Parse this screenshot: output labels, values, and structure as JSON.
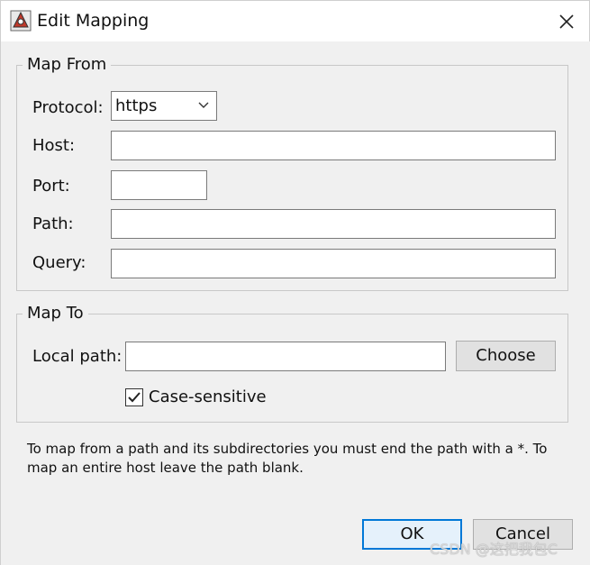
{
  "window": {
    "title": "Edit Mapping",
    "app_icon": "java-app-icon",
    "close_icon": "close-icon"
  },
  "map_from": {
    "legend": "Map From",
    "protocol_label": "Protocol:",
    "protocol_value": "https",
    "host_label": "Host:",
    "host_value": "",
    "port_label": "Port:",
    "port_value": "",
    "path_label": "Path:",
    "path_value": "",
    "query_label": "Query:",
    "query_value": ""
  },
  "map_to": {
    "legend": "Map To",
    "local_path_label": "Local path:",
    "local_path_value": "",
    "choose_label": "Choose",
    "case_sensitive_label": "Case-sensitive",
    "case_sensitive_checked": true
  },
  "help_text": "To map from a path and its subdirectories you must end the path with a *. To map an entire host leave the path blank.",
  "buttons": {
    "ok": "OK",
    "cancel": "Cancel"
  },
  "watermark": "CSDN @这把我包C",
  "colors": {
    "dialog_bg": "#f0f0f0",
    "titlebar_bg": "#ffffff",
    "default_button_border": "#0078d7"
  }
}
